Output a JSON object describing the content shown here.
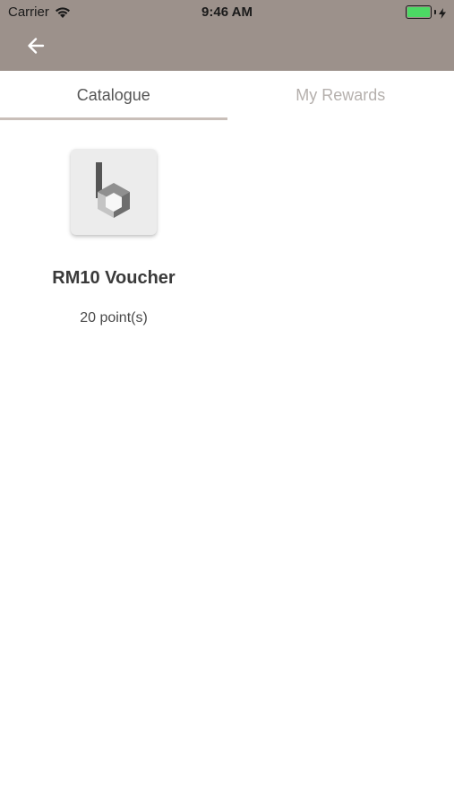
{
  "status_bar": {
    "carrier": "Carrier",
    "time": "9:46 AM",
    "battery_color": "#4cd964",
    "icons": [
      "wifi-icon",
      "battery-icon",
      "charging-bolt-icon"
    ]
  },
  "header": {
    "background_color": "#9c918b",
    "back_icon": "arrow-left-icon"
  },
  "tabs": [
    {
      "label": "Catalogue",
      "active": true
    },
    {
      "label": "My Rewards",
      "active": false
    }
  ],
  "catalogue": {
    "items": [
      {
        "title": "RM10 Voucher",
        "points": "20 point(s)",
        "icon": "brand-logo-icon"
      }
    ]
  }
}
